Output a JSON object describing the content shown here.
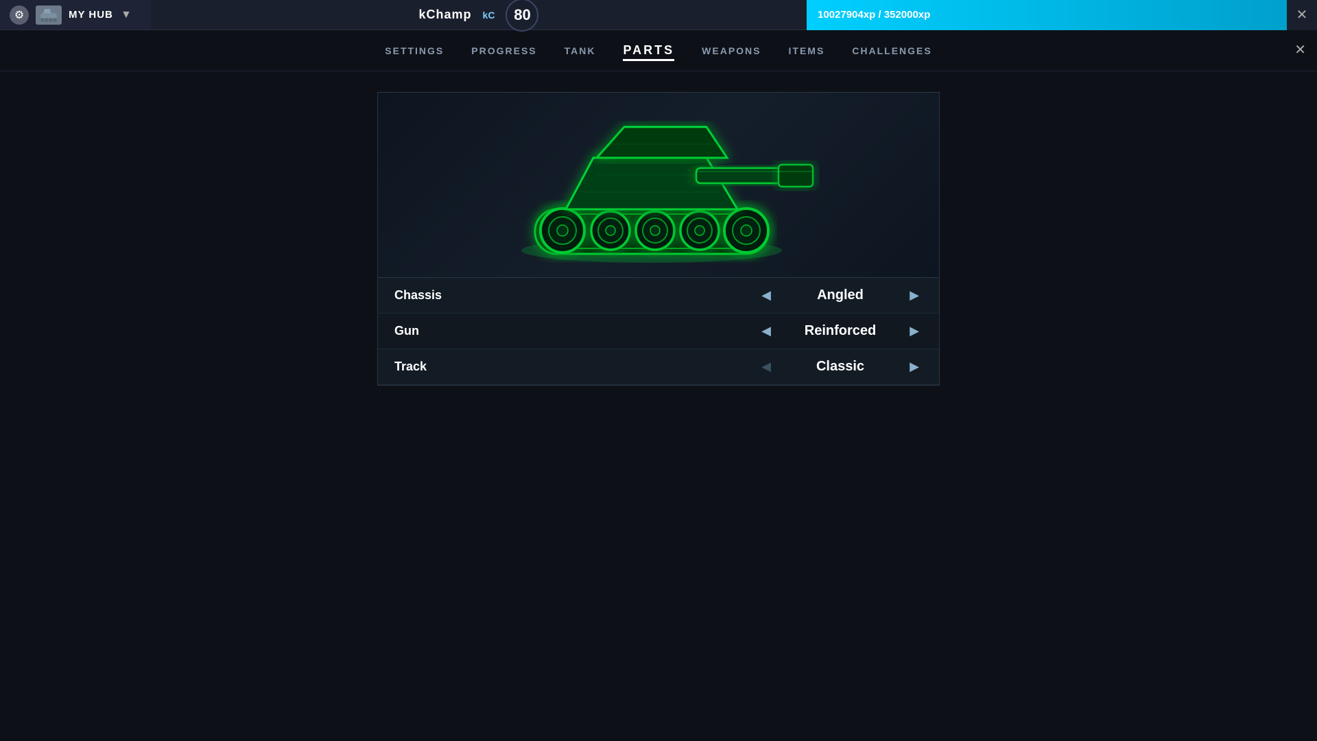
{
  "topbar": {
    "hub_label": "MY HUB",
    "username": "kChamp",
    "kc_badge": "kC",
    "level": "80",
    "xp_current": "10027904xp",
    "xp_required": "352000xp",
    "xp_display": "10027904xp / 352000xp",
    "close_label": "✕"
  },
  "nav": {
    "items": [
      {
        "id": "settings",
        "label": "SETTINGS",
        "active": false
      },
      {
        "id": "progress",
        "label": "PROGRESS",
        "active": false
      },
      {
        "id": "tank",
        "label": "TANK",
        "active": false
      },
      {
        "id": "parts",
        "label": "PARTS",
        "active": true
      },
      {
        "id": "weapons",
        "label": "WEAPONS",
        "active": false
      },
      {
        "id": "items",
        "label": "ITEMS",
        "active": false
      },
      {
        "id": "challenges",
        "label": "CHALLENGES",
        "active": false
      }
    ]
  },
  "parts": {
    "rows": [
      {
        "id": "chassis",
        "label": "Chassis",
        "value": "Angled",
        "prev_disabled": false,
        "next_disabled": false
      },
      {
        "id": "gun",
        "label": "Gun",
        "value": "Reinforced",
        "prev_disabled": false,
        "next_disabled": false
      },
      {
        "id": "track",
        "label": "Track",
        "value": "Classic",
        "prev_disabled": true,
        "next_disabled": false
      }
    ]
  },
  "icons": {
    "gear": "⚙",
    "dropdown": "▼",
    "close": "✕",
    "prev": "◀",
    "next": "▶",
    "prev_disabled": "◀",
    "next_disabled": "▶"
  },
  "colors": {
    "accent_green": "#00ff44",
    "accent_cyan": "#00cfff",
    "bg_dark": "#0d1117",
    "bg_panel": "#111820"
  }
}
